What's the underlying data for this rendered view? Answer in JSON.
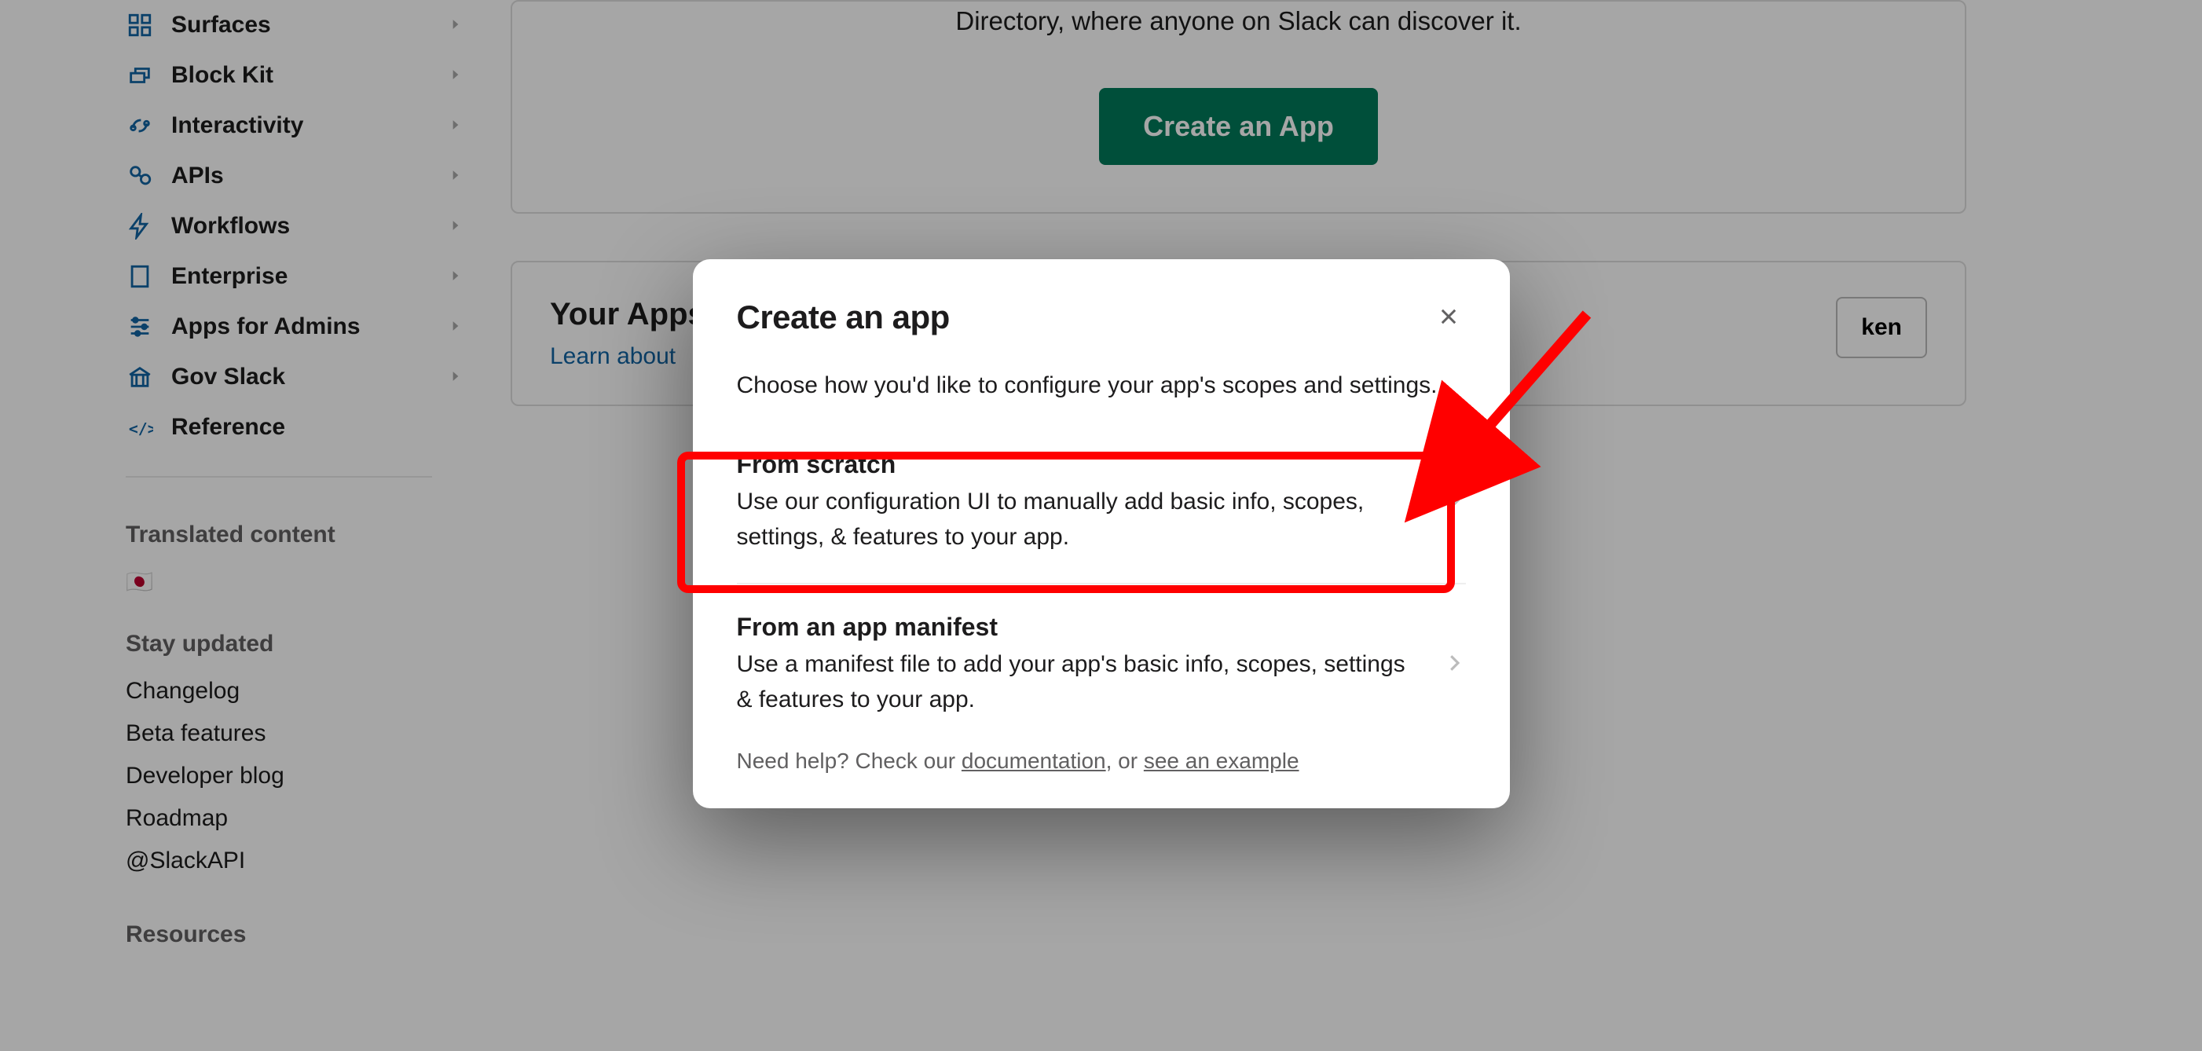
{
  "sidebar": {
    "items": [
      {
        "label": "Surfaces",
        "icon": "surfaces"
      },
      {
        "label": "Block Kit",
        "icon": "blockkit"
      },
      {
        "label": "Interactivity",
        "icon": "interactivity"
      },
      {
        "label": "APIs",
        "icon": "apis"
      },
      {
        "label": "Workflows",
        "icon": "workflows"
      },
      {
        "label": "Enterprise",
        "icon": "enterprise"
      },
      {
        "label": "Apps for Admins",
        "icon": "appsadmins"
      },
      {
        "label": "Gov Slack",
        "icon": "govslack"
      },
      {
        "label": "Reference",
        "icon": "reference",
        "no_chevron": true
      }
    ],
    "section_translated": "Translated content",
    "flag": "🇯🇵",
    "section_updates": "Stay updated",
    "updates": [
      "Changelog",
      "Beta features",
      "Developer blog",
      "Roadmap",
      "@SlackAPI"
    ],
    "section_resources": "Resources"
  },
  "hero": {
    "text_line": "Directory, where anyone on Slack can discover it.",
    "cta": "Create an App"
  },
  "your_apps": {
    "title": "Your Apps",
    "learn": "Learn about",
    "token_btn_suffix": "ken"
  },
  "modal": {
    "title": "Create an app",
    "subtitle": "Choose how you'd like to configure your app's scopes and settings.",
    "option1": {
      "title": "From scratch",
      "desc": "Use our configuration UI to manually add basic info, scopes, settings, & features to your app."
    },
    "option2": {
      "title": "From an app manifest",
      "desc": "Use a manifest file to add your app's basic info, scopes, settings & features to your app."
    },
    "help_prefix": "Need help? Check our ",
    "help_doc": "documentation",
    "help_mid": ", or ",
    "help_example": "see an example"
  },
  "annotation": {
    "highlight_target": "option-from-scratch"
  }
}
